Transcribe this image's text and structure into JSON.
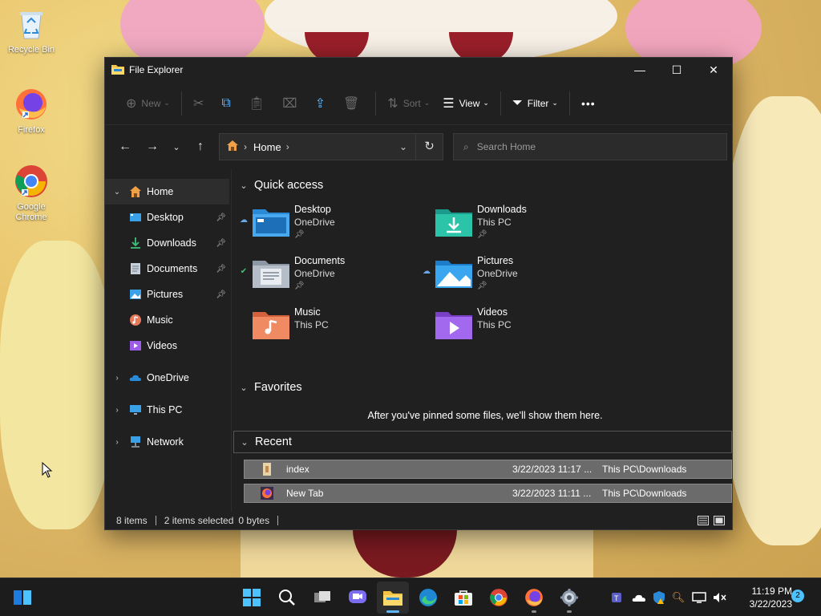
{
  "desktop": {
    "icons": [
      {
        "label": "Recycle Bin",
        "icon": "recycle-bin-icon"
      },
      {
        "label": "Firefox",
        "icon": "firefox-icon"
      },
      {
        "label": "Google Chrome",
        "icon": "chrome-icon"
      }
    ]
  },
  "window": {
    "title": "File Explorer",
    "controls": {
      "minimize": "—",
      "maximize": "☐",
      "close": "✕"
    }
  },
  "toolbar": {
    "new_label": "New",
    "sort_label": "Sort",
    "view_label": "View",
    "filter_label": "Filter",
    "more_label": "•••"
  },
  "nav": {
    "breadcrumb": "Home",
    "search_placeholder": "Search Home"
  },
  "sidebar": {
    "items": [
      {
        "label": "Home",
        "icon": "home-icon",
        "selected": true
      },
      {
        "label": "Desktop",
        "icon": "desktop-icon",
        "pinned": true
      },
      {
        "label": "Downloads",
        "icon": "download-icon",
        "pinned": true
      },
      {
        "label": "Documents",
        "icon": "documents-icon",
        "pinned": true
      },
      {
        "label": "Pictures",
        "icon": "pictures-icon",
        "pinned": true
      },
      {
        "label": "Music",
        "icon": "music-icon"
      },
      {
        "label": "Videos",
        "icon": "videos-icon"
      },
      {
        "label": "OneDrive",
        "icon": "onedrive-icon"
      },
      {
        "label": "This PC",
        "icon": "this-pc-icon"
      },
      {
        "label": "Network",
        "icon": "network-icon"
      }
    ]
  },
  "main": {
    "quick_access": {
      "title": "Quick access",
      "items": [
        {
          "name": "Desktop",
          "location": "OneDrive",
          "pinned": true,
          "status": "cloud"
        },
        {
          "name": "Downloads",
          "location": "This PC",
          "pinned": true,
          "status": ""
        },
        {
          "name": "Documents",
          "location": "OneDrive",
          "pinned": true,
          "status": "synced"
        },
        {
          "name": "Pictures",
          "location": "OneDrive",
          "pinned": true,
          "status": "cloud"
        },
        {
          "name": "Music",
          "location": "This PC",
          "pinned": false,
          "status": ""
        },
        {
          "name": "Videos",
          "location": "This PC",
          "pinned": false,
          "status": ""
        }
      ]
    },
    "favorites": {
      "title": "Favorites",
      "message": "After you've pinned some files, we'll show them here."
    },
    "recent": {
      "title": "Recent",
      "rows": [
        {
          "name": "index",
          "date": "3/22/2023 11:17 ...",
          "location": "This PC\\Downloads"
        },
        {
          "name": "New Tab",
          "date": "3/22/2023 11:11 ...",
          "location": "This PC\\Downloads"
        }
      ]
    }
  },
  "statusbar": {
    "items_count": "8 items",
    "selected": "2 items selected",
    "size": "0 bytes"
  },
  "taskbar": {
    "time": "11:19 PM",
    "date": "3/22/2023",
    "notifications": "2"
  },
  "colors": {
    "window_bg": "#202020",
    "accent": "#60b6ff",
    "folder_yellow": "#f5c447"
  }
}
